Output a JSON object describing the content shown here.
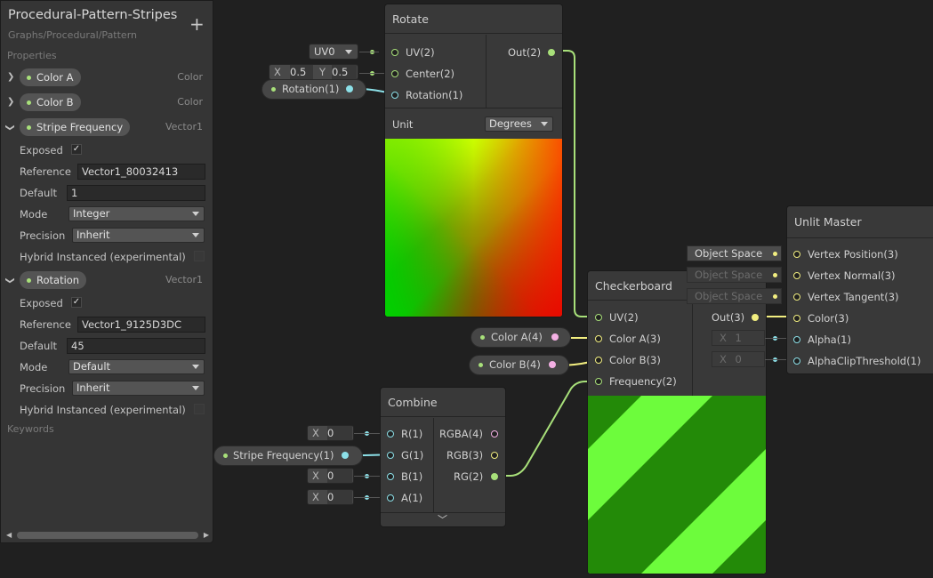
{
  "blackboard": {
    "title": "Procedural-Pattern-Stripes",
    "subtitle": "Graphs/Procedural/Pattern",
    "add_label": "+",
    "properties_label": "Properties",
    "keywords_label": "Keywords",
    "props": [
      {
        "name": "Color A",
        "type": "Color"
      },
      {
        "name": "Color B",
        "type": "Color"
      },
      {
        "name": "Stripe Frequency",
        "type": "Vector1"
      },
      {
        "name": "Rotation",
        "type": "Vector1"
      }
    ],
    "stripe": {
      "exposed_label": "Exposed",
      "exposed_mark": "✓",
      "reference_label": "Reference",
      "reference_value": "Vector1_80032413",
      "default_label": "Default",
      "default_value": "1",
      "mode_label": "Mode",
      "mode_value": "Integer",
      "precision_label": "Precision",
      "precision_value": "Inherit",
      "hybrid_label": "Hybrid Instanced (experimental)"
    },
    "rotation": {
      "exposed_label": "Exposed",
      "exposed_mark": "✓",
      "reference_label": "Reference",
      "reference_value": "Vector1_9125D3DC",
      "default_label": "Default",
      "default_value": "45",
      "mode_label": "Mode",
      "mode_value": "Default",
      "precision_label": "Precision",
      "precision_value": "Inherit",
      "hybrid_label": "Hybrid Instanced (experimental)"
    }
  },
  "rotate_node": {
    "title": "Rotate",
    "inputs": [
      "UV(2)",
      "Center(2)",
      "Rotation(1)"
    ],
    "output": "Out(2)",
    "unit_label": "Unit",
    "unit_value": "Degrees",
    "uv_value": "UV0",
    "center_x_label": "X",
    "center_x": "0.5",
    "center_y_label": "Y",
    "center_y": "0.5",
    "rotation_prop": "Rotation(1)"
  },
  "checker_node": {
    "title": "Checkerboard",
    "inputs": [
      "UV(2)",
      "Color A(3)",
      "Color B(3)",
      "Frequency(2)"
    ],
    "output": "Out(3)",
    "color_a_prop": "Color A(4)",
    "color_b_prop": "Color B(4)",
    "colors": {
      "light": "#6dfc3c",
      "dark": "#238a08"
    }
  },
  "combine_node": {
    "title": "Combine",
    "inputs": [
      "R(1)",
      "G(1)",
      "B(1)",
      "A(1)"
    ],
    "outputs": [
      "RGBA(4)",
      "RGB(3)",
      "RG(2)"
    ],
    "r_label": "X",
    "r_value": "0",
    "b_label": "X",
    "b_value": "0",
    "a_label": "X",
    "a_value": "0",
    "g_prop": "Stripe Frequency(1)",
    "expand_icon": "chevron-down-icon"
  },
  "master_node": {
    "title": "Unlit Master",
    "inputs": [
      "Vertex Position(3)",
      "Vertex Normal(3)",
      "Vertex Tangent(3)",
      "Color(3)",
      "Alpha(1)",
      "AlphaClipThreshold(1)"
    ],
    "space_label": "Object Space",
    "alpha_label": "X",
    "alpha_value": "1",
    "clip_label": "X",
    "clip_value": "0"
  },
  "colors": {
    "vector2": "#a8e07a",
    "vector3": "#f2ee80",
    "vector4": "#f4b0e4",
    "vector1": "#8ce0e8"
  }
}
